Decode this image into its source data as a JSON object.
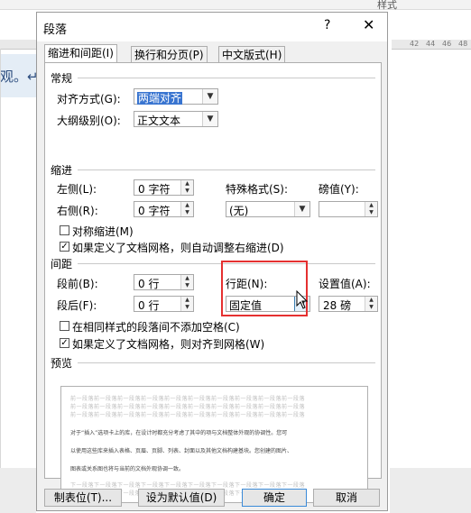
{
  "background": {
    "style_label": "样式",
    "left_text": "观。↵",
    "ruler_numbers": [
      "42",
      "44",
      "46",
      "48"
    ]
  },
  "dialog": {
    "title": "段落",
    "help": "?",
    "close": "✕",
    "tabs": [
      {
        "label": "缩进和间距(I)",
        "active": true
      },
      {
        "label": "换行和分页(P)",
        "active": false
      },
      {
        "label": "中文版式(H)",
        "active": false
      }
    ],
    "general": {
      "title": "常规",
      "alignment_label": "对齐方式(G):",
      "alignment_value": "两端对齐",
      "outline_label": "大纲级别(O):",
      "outline_value": "正文文本"
    },
    "indent": {
      "title": "缩进",
      "left_label": "左侧(L):",
      "left_value": "0 字符",
      "right_label": "右侧(R):",
      "right_value": "0 字符",
      "special_label": "特殊格式(S):",
      "special_value": "(无)",
      "by_label": "磅值(Y):",
      "by_value": "",
      "mirror_label": "对称缩进(M)",
      "mirror_checked": false,
      "auto_right_label": "如果定义了文档网格，则自动调整右缩进(D)",
      "auto_right_checked": true
    },
    "spacing": {
      "title": "间距",
      "before_label": "段前(B):",
      "before_value": "0 行",
      "after_label": "段后(F):",
      "after_value": "0 行",
      "line_label": "行距(N):",
      "line_value": "固定值",
      "at_label": "设置值(A):",
      "at_value": "28 磅",
      "no_space_label": "在相同样式的段落间不添加空格(C)",
      "no_space_checked": false,
      "snap_grid_label": "如果定义了文档网格，则对齐到网格(W)",
      "snap_grid_checked": true
    },
    "preview": {
      "title": "预览",
      "prev_paragraph": "前一段落前一段落前一段落前一段落前一段落前一段落前一段落前一段落前一段落前一段落",
      "sample_lines": [
        "对于“插入”选项卡上的库，在设计时都充分考虑了其中的项与文档整体外观的协调性。您可",
        "以使用这些库来插入表格、页眉、页脚、列表、封面以及其他文档构建基块。您创建的图片、",
        "图表或关系图也将与当前的文档外观协调一致。"
      ],
      "next_paragraph": "下一段落下一段落下一段落下一段落下一段落下一段落下一段落下一段落下一段落下一段落"
    },
    "buttons": {
      "tabs": "制表位(T)...",
      "set_default": "设为默认值(D)",
      "ok": "确定",
      "cancel": "取消"
    }
  }
}
